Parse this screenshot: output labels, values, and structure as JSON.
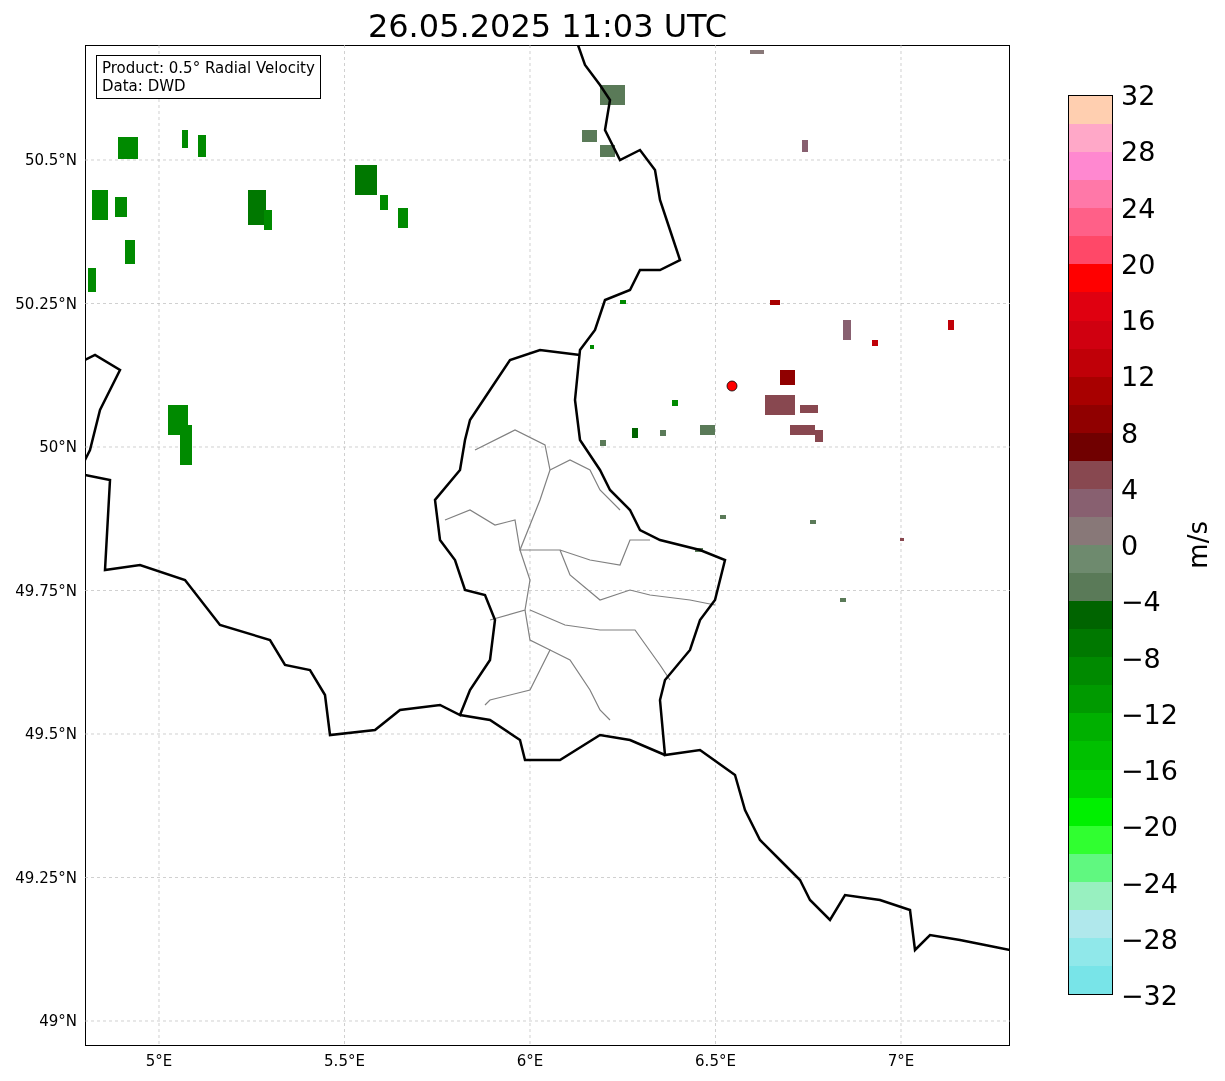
{
  "title": "26.05.2025 11:03 UTC",
  "legend": [
    "Product: 0.5° Radial Velocity",
    "Data: DWD"
  ],
  "map": {
    "y_tick_labels": [
      "50.5°N",
      "50.25°N",
      "50°N",
      "49.75°N",
      "49.5°N",
      "49.25°N",
      "49°N"
    ],
    "x_tick_labels": [
      "5°E",
      "5.5°E",
      "6°E",
      "6.5°E",
      "7°E"
    ]
  },
  "colorbar": {
    "label": "m/s",
    "tick_labels": [
      "32",
      "28",
      "24",
      "20",
      "16",
      "12",
      "8",
      "4",
      "0",
      "−4",
      "−8",
      "−12",
      "−16",
      "−20",
      "−24",
      "−28",
      "−32"
    ],
    "segments": [
      {
        "color": "#ffcfb0"
      },
      {
        "color": "#ffa8c8"
      },
      {
        "color": "#ff88d0"
      },
      {
        "color": "#ff78a8"
      },
      {
        "color": "#ff6088"
      },
      {
        "color": "#ff4868"
      },
      {
        "color": "#ff0000"
      },
      {
        "color": "#e00010"
      },
      {
        "color": "#d00010"
      },
      {
        "color": "#c00008"
      },
      {
        "color": "#a80000"
      },
      {
        "color": "#900000"
      },
      {
        "color": "#700000"
      },
      {
        "color": "#884850"
      },
      {
        "color": "#886070"
      },
      {
        "color": "#887878"
      },
      {
        "color": "#6e8a6e"
      },
      {
        "color": "#5a7a58"
      },
      {
        "color": "#006400"
      },
      {
        "color": "#007800"
      },
      {
        "color": "#008a00"
      },
      {
        "color": "#009a00"
      },
      {
        "color": "#00b000"
      },
      {
        "color": "#00c000"
      },
      {
        "color": "#00d000"
      },
      {
        "color": "#00f000"
      },
      {
        "color": "#30ff30"
      },
      {
        "color": "#60f880"
      },
      {
        "color": "#98f0c0"
      },
      {
        "color": "#b0e8ec"
      },
      {
        "color": "#90e8ea"
      },
      {
        "color": "#78e4e8"
      }
    ]
  }
}
